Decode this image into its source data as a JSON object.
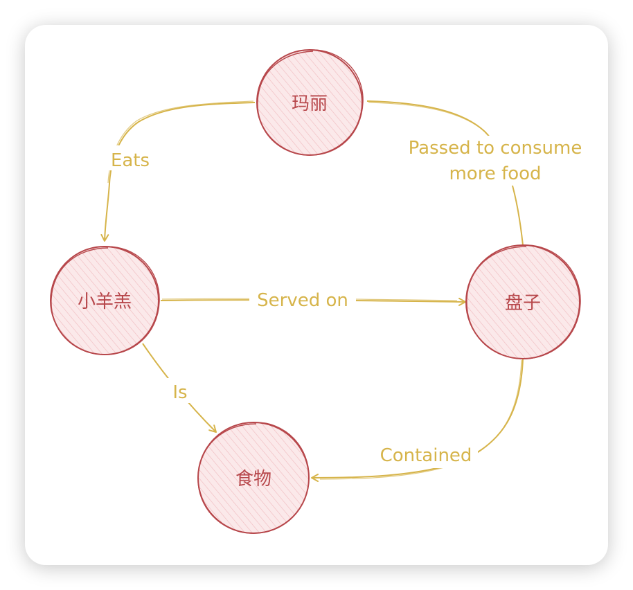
{
  "colors": {
    "node_stroke": "#b7474b",
    "node_fill": "#f9dfe1",
    "edge": "#d6b44a",
    "card_background": "#ffffff"
  },
  "nodes": {
    "mary": {
      "label": "玛丽"
    },
    "lamb": {
      "label": "小羊羔"
    },
    "plate": {
      "label": "盘子"
    },
    "food": {
      "label": "食物"
    }
  },
  "edges": {
    "eats": {
      "label": "Eats"
    },
    "passed": {
      "label_line1": "Passed to consume",
      "label_line2": "more food"
    },
    "served_on": {
      "label": "Served on"
    },
    "is": {
      "label": "Is"
    },
    "contained": {
      "label": "Contained"
    }
  }
}
